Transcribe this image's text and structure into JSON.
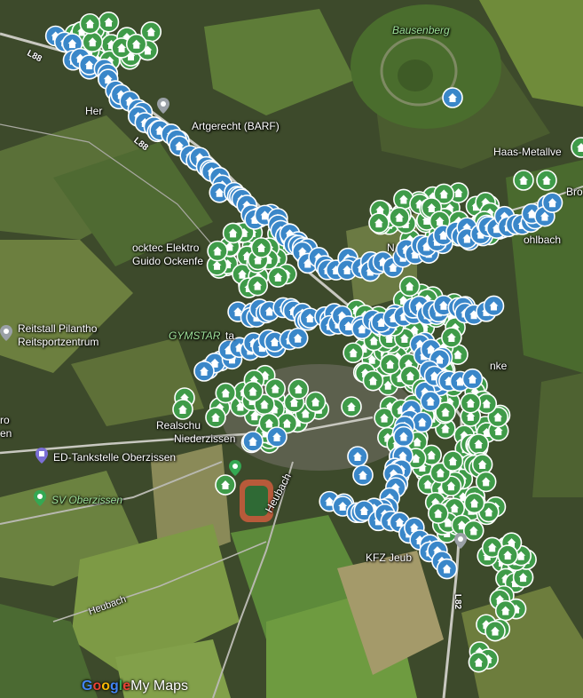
{
  "map": {
    "place_labels": [
      {
        "id": "bausenberg",
        "text": "Bausenberg",
        "style": "green"
      },
      {
        "id": "artgerecht",
        "text": "Artgerecht (BARF)",
        "style": "white"
      },
      {
        "id": "haas",
        "text": "Haas-Metallve",
        "style": "white"
      },
      {
        "id": "ocktec1",
        "text": "ocktec Elektro",
        "style": "white"
      },
      {
        "id": "ocktec2",
        "text": "Guido Ockenfe",
        "style": "white"
      },
      {
        "id": "reitstall1",
        "text": "Reitstall Pilantho",
        "style": "white"
      },
      {
        "id": "reitstall2",
        "text": "Reitsportzentrum",
        "style": "white"
      },
      {
        "id": "gymstar",
        "text": "GYMSTAR",
        "style": "green"
      },
      {
        "id": "realschule1",
        "text": "Realschu",
        "style": "white"
      },
      {
        "id": "realschule2",
        "text": "Niederzissen",
        "style": "white"
      },
      {
        "id": "ed",
        "text": "ED-Tankstelle Oberzissen",
        "style": "white"
      },
      {
        "id": "sv",
        "text": "SV Oberzissen",
        "style": "green"
      },
      {
        "id": "kfz",
        "text": "KFZ Jeub",
        "style": "white"
      },
      {
        "id": "heubach1",
        "text": "Heubach",
        "style": "white"
      },
      {
        "id": "heubach2",
        "text": "Heubach",
        "style": "white"
      },
      {
        "id": "her",
        "text": "Her",
        "style": "white"
      },
      {
        "id": "nf",
        "text": "N",
        "style": "white"
      },
      {
        "id": "nke",
        "text": "nke",
        "style": "white"
      },
      {
        "id": "bro",
        "text": "Bro",
        "style": "white"
      },
      {
        "id": "ohlbach",
        "text": "ohlbach",
        "style": "white"
      },
      {
        "id": "ro",
        "text": "ro",
        "style": "white"
      },
      {
        "id": "en",
        "text": "en",
        "style": "white"
      },
      {
        "id": "ta",
        "text": "ta",
        "style": "white"
      }
    ],
    "road_labels": [
      {
        "id": "l88a",
        "text": "L88"
      },
      {
        "id": "l88b",
        "text": "L88"
      },
      {
        "id": "l82",
        "text": "L82"
      }
    ],
    "marker_groups": [
      {
        "name": "green-houses",
        "color": "#3f9b49"
      },
      {
        "name": "blue-houses",
        "color": "#3a87c9"
      }
    ],
    "logo": {
      "google": "Google",
      "mymaps": " My Maps"
    }
  }
}
